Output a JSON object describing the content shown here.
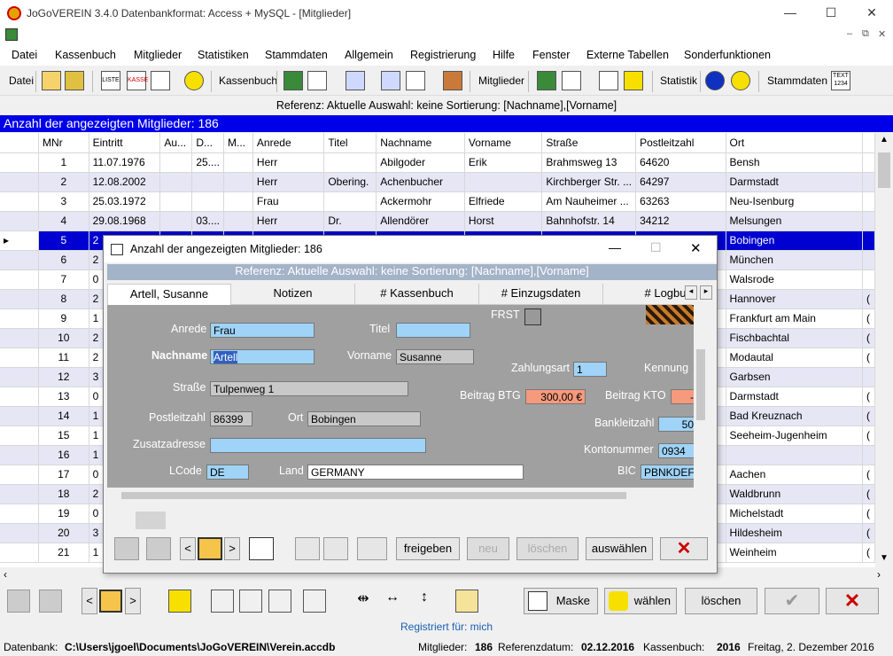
{
  "app": {
    "title": "JoGoVEREIN 3.4.0 Datenbankformat: Access + MySQL - [Mitglieder]",
    "win_min": "—",
    "win_max": "☐",
    "win_close": "✕",
    "mdi_min": "–",
    "mdi_restore": "⧉",
    "mdi_close": "✕"
  },
  "menu": [
    "Datei",
    "Kassenbuch",
    "Mitglieder",
    "Statistiken",
    "Stammdaten",
    "Allgemein",
    "Registrierung",
    "Hilfe",
    "Fenster",
    "Externe Tabellen",
    "Sonderfunktionen"
  ],
  "toolbar": {
    "datei": "Datei",
    "kassenbuch": "Kassenbuch",
    "mitglieder": "Mitglieder",
    "statistik": "Statistik",
    "stammdaten": "Stammdaten",
    "liste": "LISTE",
    "kasse": "KASSE",
    "text": "TEXT 1234"
  },
  "reference": "Referenz: Aktuelle  Auswahl: keine  Sortierung: [Nachname],[Vorname]",
  "count_label": "Anzahl der angezeigten Mitglieder: 186",
  "grid": {
    "columns": [
      "MNr",
      "Eintritt",
      "Au...",
      "D...",
      "M...",
      "Anrede",
      "Titel",
      "Nachname",
      "Vorname",
      "Straße",
      "Postleitzahl",
      "Ort"
    ],
    "rows": [
      {
        "mnr": "1",
        "eintritt": "11.07.1976",
        "au": "",
        "d": "25....",
        "m": "",
        "anrede": "Herr",
        "titel": "",
        "nachname": "Abilgoder",
        "vorname": "Erik",
        "strasse": "Brahmsweg 13",
        "plz": "64620",
        "ort": "Bensh",
        "x": ""
      },
      {
        "mnr": "2",
        "eintritt": "12.08.2002",
        "au": "",
        "d": "",
        "m": "",
        "anrede": "Herr",
        "titel": "Obering.",
        "nachname": "Achenbucher",
        "vorname": "",
        "strasse": "Kirchberger Str. ...",
        "plz": "64297",
        "ort": "Darmstadt",
        "x": ""
      },
      {
        "mnr": "3",
        "eintritt": "25.03.1972",
        "au": "",
        "d": "",
        "m": "",
        "anrede": "Frau",
        "titel": "",
        "nachname": "Ackermohr",
        "vorname": "Elfriede",
        "strasse": "Am Nauheimer ...",
        "plz": "63263",
        "ort": "Neu-Isenburg",
        "x": ""
      },
      {
        "mnr": "4",
        "eintritt": "29.08.1968",
        "au": "",
        "d": "03....",
        "m": "",
        "anrede": "Herr",
        "titel": "Dr.",
        "nachname": "Allendörer",
        "vorname": "Horst",
        "strasse": "Bahnhofstr. 14",
        "plz": "34212",
        "ort": "Melsungen",
        "x": ""
      },
      {
        "mnr": "5",
        "eintritt": "2",
        "au": "",
        "d": "",
        "m": "",
        "anrede": "",
        "titel": "",
        "nachname": "",
        "vorname": "",
        "strasse": "",
        "plz": "",
        "ort": "Bobingen",
        "x": ""
      },
      {
        "mnr": "6",
        "eintritt": "2",
        "au": "",
        "d": "",
        "m": "",
        "anrede": "",
        "titel": "",
        "nachname": "",
        "vorname": "",
        "strasse": "",
        "plz": "",
        "ort": "München",
        "x": ""
      },
      {
        "mnr": "7",
        "eintritt": "0",
        "au": "",
        "d": "",
        "m": "",
        "anrede": "",
        "titel": "",
        "nachname": "",
        "vorname": "",
        "strasse": "",
        "plz": "",
        "ort": "Walsrode",
        "x": ""
      },
      {
        "mnr": "8",
        "eintritt": "2",
        "au": "",
        "d": "",
        "m": "",
        "anrede": "",
        "titel": "",
        "nachname": "",
        "vorname": "",
        "strasse": "",
        "plz": "",
        "ort": "Hannover",
        "x": "("
      },
      {
        "mnr": "9",
        "eintritt": "1",
        "au": "",
        "d": "",
        "m": "",
        "anrede": "",
        "titel": "",
        "nachname": "",
        "vorname": "",
        "strasse": "",
        "plz": "",
        "ort": "Frankfurt am Main",
        "x": "("
      },
      {
        "mnr": "10",
        "eintritt": "2",
        "au": "",
        "d": "",
        "m": "",
        "anrede": "",
        "titel": "",
        "nachname": "",
        "vorname": "",
        "strasse": "",
        "plz": "",
        "ort": "Fischbachtal",
        "x": "("
      },
      {
        "mnr": "11",
        "eintritt": "2",
        "au": "",
        "d": "",
        "m": "",
        "anrede": "",
        "titel": "",
        "nachname": "",
        "vorname": "",
        "strasse": "",
        "plz": "",
        "ort": "Modautal",
        "x": "("
      },
      {
        "mnr": "12",
        "eintritt": "3",
        "au": "",
        "d": "",
        "m": "",
        "anrede": "",
        "titel": "",
        "nachname": "",
        "vorname": "",
        "strasse": "",
        "plz": "",
        "ort": "Garbsen",
        "x": ""
      },
      {
        "mnr": "13",
        "eintritt": "0",
        "au": "",
        "d": "",
        "m": "",
        "anrede": "",
        "titel": "",
        "nachname": "",
        "vorname": "",
        "strasse": "",
        "plz": "",
        "ort": "Darmstadt",
        "x": "("
      },
      {
        "mnr": "14",
        "eintritt": "1",
        "au": "",
        "d": "",
        "m": "",
        "anrede": "",
        "titel": "",
        "nachname": "",
        "vorname": "",
        "strasse": "",
        "plz": "",
        "ort": "Bad Kreuznach",
        "x": "("
      },
      {
        "mnr": "15",
        "eintritt": "1",
        "au": "",
        "d": "",
        "m": "",
        "anrede": "",
        "titel": "",
        "nachname": "",
        "vorname": "",
        "strasse": "",
        "plz": "",
        "ort": "Seeheim-Jugenheim",
        "x": "("
      },
      {
        "mnr": "16",
        "eintritt": "1",
        "au": "",
        "d": "",
        "m": "",
        "anrede": "",
        "titel": "",
        "nachname": "",
        "vorname": "",
        "strasse": "",
        "plz": "",
        "ort": "",
        "x": ""
      },
      {
        "mnr": "17",
        "eintritt": "0",
        "au": "",
        "d": "",
        "m": "",
        "anrede": "",
        "titel": "",
        "nachname": "",
        "vorname": "",
        "strasse": "",
        "plz": "",
        "ort": "Aachen",
        "x": "("
      },
      {
        "mnr": "18",
        "eintritt": "2",
        "au": "",
        "d": "",
        "m": "",
        "anrede": "",
        "titel": "",
        "nachname": "",
        "vorname": "",
        "strasse": "",
        "plz": "",
        "ort": "Waldbrunn",
        "x": "("
      },
      {
        "mnr": "19",
        "eintritt": "0",
        "au": "",
        "d": "",
        "m": "",
        "anrede": "",
        "titel": "",
        "nachname": "",
        "vorname": "",
        "strasse": "",
        "plz": "",
        "ort": "Michelstadt",
        "x": "("
      },
      {
        "mnr": "20",
        "eintritt": "3",
        "au": "",
        "d": "",
        "m": "",
        "anrede": "",
        "titel": "",
        "nachname": "",
        "vorname": "",
        "strasse": "",
        "plz": "",
        "ort": "Hildesheim",
        "x": "("
      },
      {
        "mnr": "21",
        "eintritt": "1",
        "au": "",
        "d": "",
        "m": "",
        "anrede": "",
        "titel": "",
        "nachname": "",
        "vorname": "",
        "strasse": "",
        "plz": "",
        "ort": "Weinheim",
        "x": "("
      }
    ],
    "selected_row": 4
  },
  "dialog": {
    "title": "Anzahl der angezeigten Mitglieder: 186",
    "reference": "Referenz: Aktuelle  Auswahl: keine  Sortierung: [Nachname],[Vorname]",
    "tabs": [
      "Artell, Susanne",
      "Notizen",
      "# Kassenbuch",
      "# Einzugsdaten",
      "# Logbuc"
    ],
    "form": {
      "anrede_label": "Anrede",
      "anrede": "Frau",
      "titel_label": "Titel",
      "titel": "",
      "frst_label": "FRST",
      "nachname_label": "Nachname",
      "nachname": "Artell",
      "vorname_label": "Vorname",
      "vorname": "Susanne",
      "zahlungsart_label": "Zahlungsart",
      "zahlungsart": "1",
      "kennung_label": "Kennung",
      "strasse_label": "Straße",
      "strasse": "Tulpenweg 1",
      "beitrag_btg_label": "Beitrag BTG",
      "beitrag_btg": "300,00 €",
      "beitrag_kto_label": "Beitrag KTO",
      "beitrag_kto": "-",
      "plz_label": "Postleitzahl",
      "plz": "86399",
      "ort_label": "Ort",
      "ort": "Bobingen",
      "bankleitzahl_label": "Bankleitzahl",
      "bankleitzahl": "50",
      "zusatz_label": "Zusatzadresse",
      "zusatz": "",
      "kontonummer_label": "Kontonummer",
      "kontonummer": "0934",
      "lcode_label": "LCode",
      "lcode": "DE",
      "land_label": "Land",
      "land": "GERMANY",
      "bic_label": "BIC",
      "bic": "PBNKDEF"
    },
    "buttons": {
      "freigeben": "freigeben",
      "neu": "neu",
      "loeschen": "löschen",
      "auswaehlen": "auswählen",
      "prev": "<",
      "next": ">"
    }
  },
  "bottom": {
    "maske": "Maske",
    "waehlen": "wählen",
    "loeschen": "löschen",
    "prev": "<",
    "next": ">"
  },
  "registered": "Registriert für: mich",
  "status": {
    "db_label": "Datenbank:",
    "db_path": "C:\\Users\\jgoel\\Documents\\JoGoVEREIN\\Verein.accdb",
    "mitglieder_label": "Mitglieder:",
    "mitglieder": "186",
    "ref_label": "Referenzdatum:",
    "ref_date": "02.12.2016",
    "kasse_label": "Kassenbuch:",
    "kasse": "2016",
    "date": "Freitag, 2. Dezember 2016"
  },
  "colors": {
    "selection": "#0000d0",
    "count_bar": "#0000e8",
    "form_bg": "#a0a0a0",
    "field_blue": "#9fd3f7",
    "field_salmon": "#f59a7d",
    "cancel_red": "#cc0000"
  }
}
